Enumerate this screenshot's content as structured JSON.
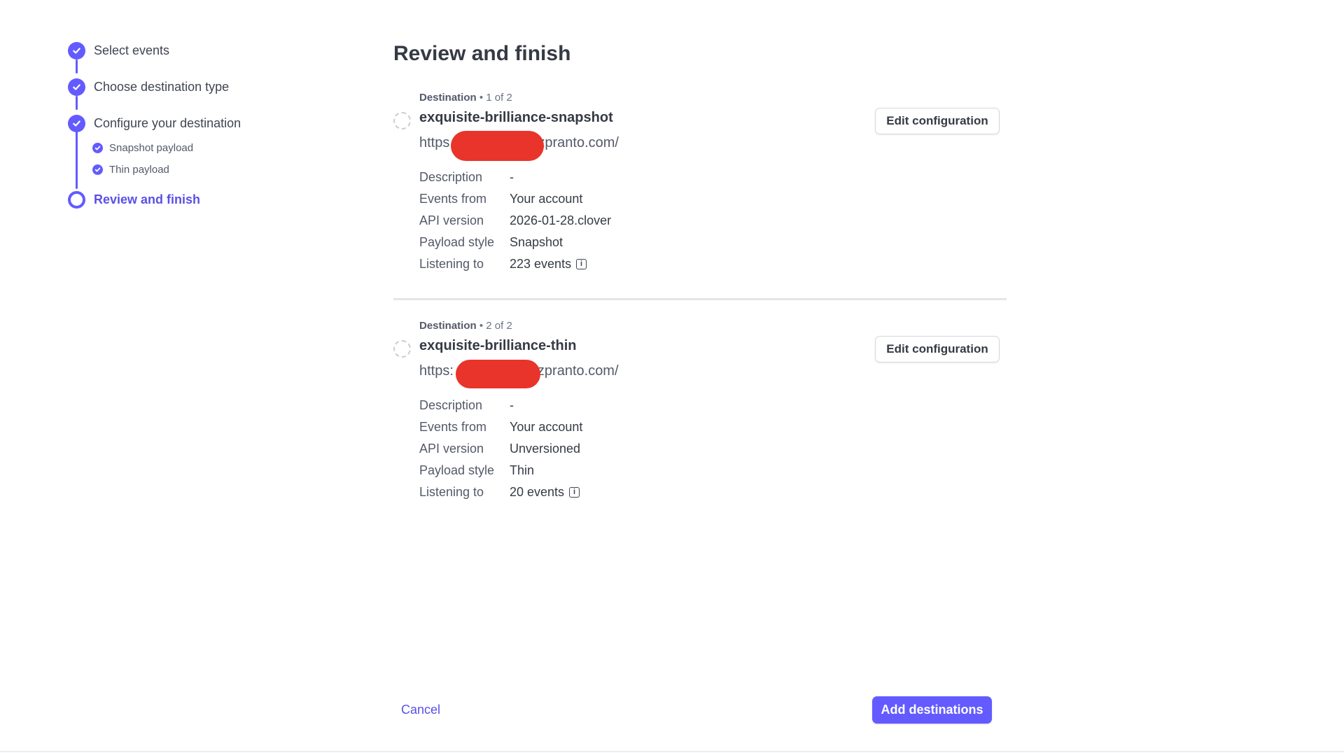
{
  "stepper": {
    "steps": [
      {
        "label": "Select events",
        "state": "done"
      },
      {
        "label": "Choose destination type",
        "state": "done"
      },
      {
        "label": "Configure your destination",
        "state": "done"
      },
      {
        "label": "Review and finish",
        "state": "current"
      }
    ],
    "substeps": [
      {
        "label": "Snapshot payload",
        "state": "done"
      },
      {
        "label": "Thin payload",
        "state": "done"
      }
    ]
  },
  "main": {
    "title": "Review and finish",
    "destinations": [
      {
        "heading": "Destination",
        "position": "1 of 2",
        "name": "exquisite-brilliance-snapshot",
        "url_prefix": "https",
        "url_suffix": "zpranto.com/",
        "edit_label": "Edit configuration",
        "details": [
          {
            "key": "Description",
            "value": "-"
          },
          {
            "key": "Events from",
            "value": "Your account"
          },
          {
            "key": "API version",
            "value": "2026-01-28.clover"
          },
          {
            "key": "Payload style",
            "value": "Snapshot"
          },
          {
            "key": "Listening to",
            "value": "223 events"
          }
        ]
      },
      {
        "heading": "Destination",
        "position": "2 of 2",
        "name": "exquisite-brilliance-thin",
        "url_prefix": "https:",
        "url_suffix": "zpranto.com/",
        "edit_label": "Edit configuration",
        "details": [
          {
            "key": "Description",
            "value": "-"
          },
          {
            "key": "Events from",
            "value": "Your account"
          },
          {
            "key": "API version",
            "value": "Unversioned"
          },
          {
            "key": "Payload style",
            "value": "Thin"
          },
          {
            "key": "Listening to",
            "value": "20 events"
          }
        ]
      }
    ]
  },
  "footer": {
    "cancel_label": "Cancel",
    "submit_label": "Add destinations"
  },
  "colors": {
    "accent": "#635bff",
    "redaction": "#e8342a"
  },
  "icons": {
    "step_done": "check-circle-icon",
    "step_current": "ring-icon",
    "info": "info-icon",
    "pending": "dashed-circle-icon"
  }
}
